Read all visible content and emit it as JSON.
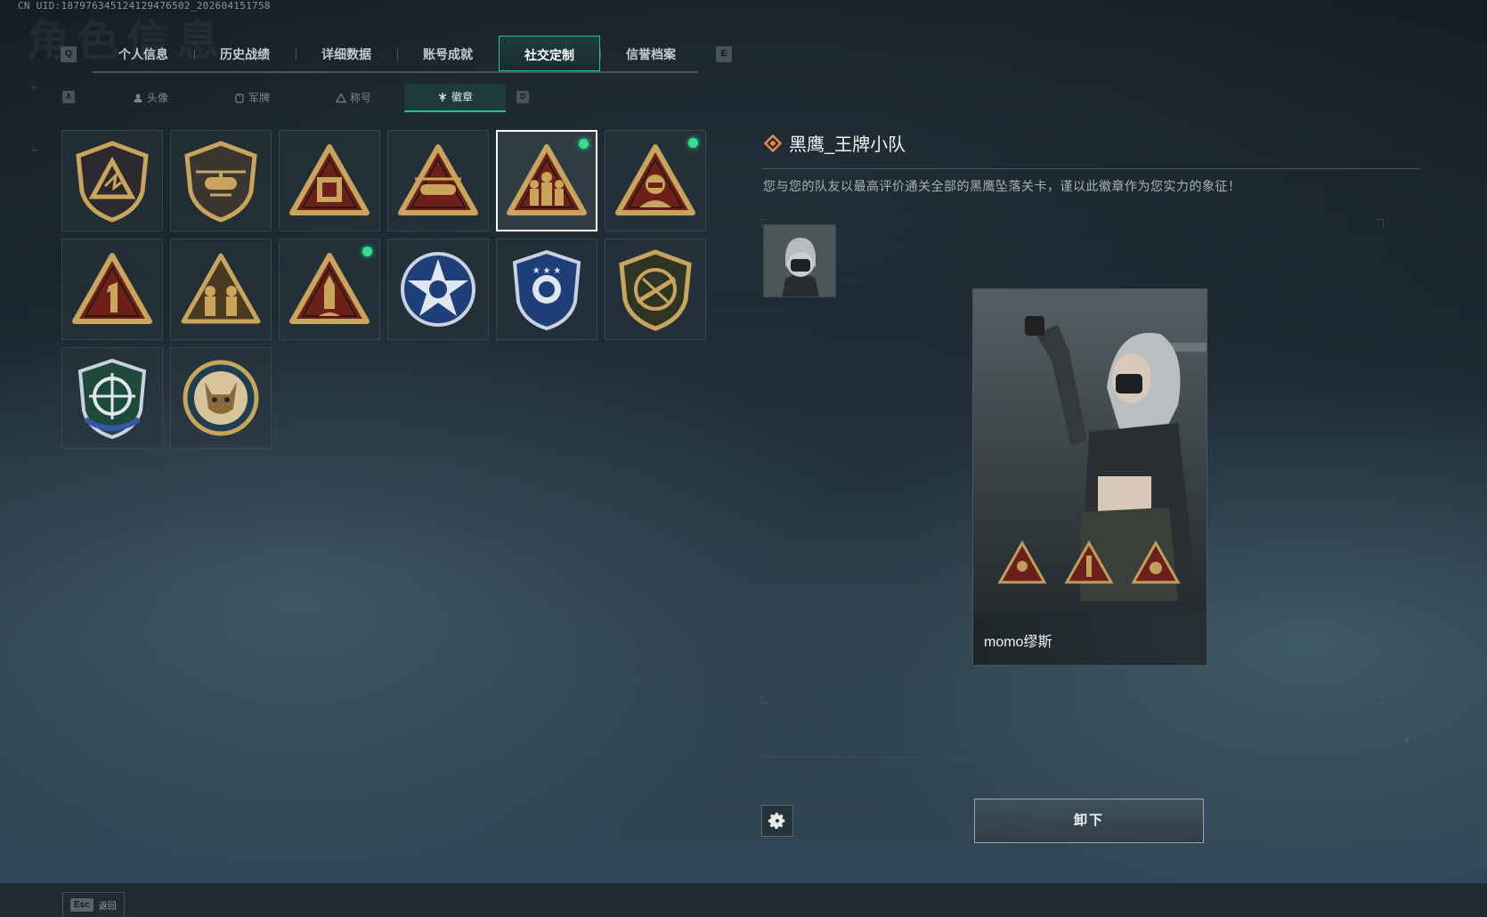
{
  "uid": "CN UID:187976345124129476502_202604151758",
  "bg_title": "角色信息",
  "keys": {
    "left_tab": "Q",
    "right_tab": "E",
    "left_sub": "A",
    "right_sub": "D"
  },
  "tabs": [
    {
      "label": "个人信息",
      "active": false
    },
    {
      "label": "历史战绩",
      "active": false
    },
    {
      "label": "详细数据",
      "active": false
    },
    {
      "label": "账号成就",
      "active": false
    },
    {
      "label": "社交定制",
      "active": true
    },
    {
      "label": "信誉档案",
      "active": false
    }
  ],
  "subtabs": [
    {
      "label": "头像",
      "icon": "person-icon",
      "active": false
    },
    {
      "label": "军牌",
      "icon": "dogtag-icon",
      "active": false
    },
    {
      "label": "称号",
      "icon": "triangle-icon",
      "active": false
    },
    {
      "label": "徽章",
      "icon": "emblem-icon",
      "active": true
    }
  ],
  "badges": [
    {
      "icon": "shield-triangle-badge-icon",
      "new": false,
      "selected": false
    },
    {
      "icon": "helicopter-shield-badge-icon",
      "new": false,
      "selected": false
    },
    {
      "icon": "fortress-triangle-badge-icon",
      "new": false,
      "selected": false
    },
    {
      "icon": "helicopter-triangle-badge-icon",
      "new": false,
      "selected": false
    },
    {
      "icon": "squad-triangle-badge-icon",
      "new": true,
      "selected": true
    },
    {
      "icon": "soldier-triangle-badge-icon",
      "new": true,
      "selected": false
    },
    {
      "icon": "number-one-triangle-badge-icon",
      "new": false,
      "selected": false
    },
    {
      "icon": "troops-triangle-badge-icon",
      "new": false,
      "selected": false
    },
    {
      "icon": "missile-triangle-badge-icon",
      "new": true,
      "selected": false
    },
    {
      "icon": "star-crest-badge-icon",
      "new": false,
      "selected": false
    },
    {
      "icon": "wing-shield-badge-icon",
      "new": false,
      "selected": false
    },
    {
      "icon": "rifle-shield-badge-icon",
      "new": false,
      "selected": false
    },
    {
      "icon": "crosshair-shield-badge-icon",
      "new": false,
      "selected": false
    },
    {
      "icon": "lynx-round-badge-icon",
      "new": false,
      "selected": false
    }
  ],
  "detail": {
    "title": "黑鹰_王牌小队",
    "description": "您与您的队友以最高评价通关全部的黑鹰坠落关卡，谨以此徽章作为您实力的象征！",
    "player_name": "momo缪斯",
    "unequip_label": "卸下"
  },
  "bottom": {
    "esc_key": "Esc",
    "back_label": "返回"
  },
  "colors": {
    "accent": "#2dc08e",
    "new_dot": "#2ee08f",
    "badge_gold": "#c9a45c",
    "badge_red": "#6e1f1a"
  }
}
